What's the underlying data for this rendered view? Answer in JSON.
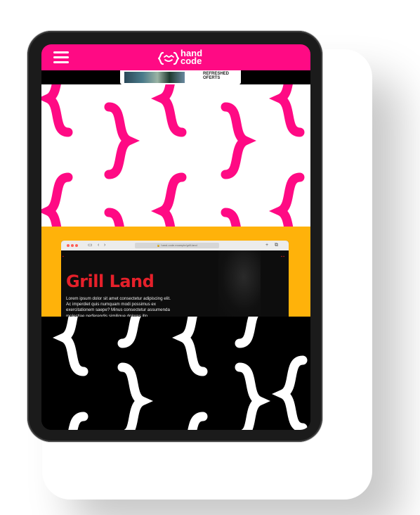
{
  "header": {
    "menu_icon": "hamburger-icon",
    "logo_icon": "braces-smile-icon",
    "logo_text": "hand\ncode",
    "background": "#ff0a84"
  },
  "strip": {
    "text": "REFRESHED\nOFERTS"
  },
  "browser": {
    "url": "🔒  hand-code.example/grill-land",
    "grill_title": "Grill Land",
    "grill_body": "Lorem ipsum dolor sit amet consectetur adipiscing elit. Ac imperdiet quis numquam modi possimus ex exercitationem saepe? Minus consectetur assumenda molestiae perferendis similique dolores illo."
  },
  "colors": {
    "pink": "#ff0a84",
    "yellow": "#ffb20a",
    "red": "#e5202a"
  }
}
